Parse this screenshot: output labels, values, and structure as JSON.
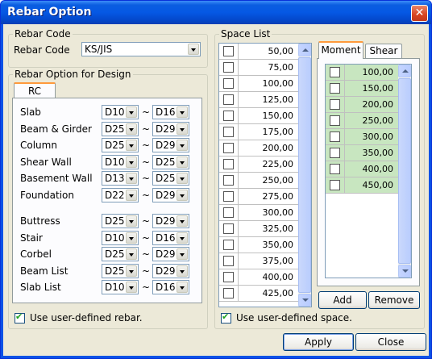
{
  "window": {
    "title": "Rebar Option",
    "close_glyph": "✕"
  },
  "rebar_code": {
    "group_label": "Rebar Code",
    "label": "Rebar Code",
    "value": "KS/JIS"
  },
  "design": {
    "group_label": "Rebar Option for Design",
    "tab": "RC",
    "tilde": "~",
    "rows": [
      {
        "label": "Slab",
        "min": "D10",
        "max": "D16"
      },
      {
        "label": "Beam & Girder",
        "min": "D25",
        "max": "D29"
      },
      {
        "label": "Column",
        "min": "D25",
        "max": "D29"
      },
      {
        "label": "Shear Wall",
        "min": "D10",
        "max": "D25"
      },
      {
        "label": "Basement Wall",
        "min": "D13",
        "max": "D25"
      },
      {
        "label": "Foundation",
        "min": "D22",
        "max": "D29"
      },
      {
        "label": "Buttress",
        "min": "D25",
        "max": "D29"
      },
      {
        "label": "Stair",
        "min": "D10",
        "max": "D16"
      },
      {
        "label": "Corbel",
        "min": "D25",
        "max": "D29"
      },
      {
        "label": "Beam List",
        "min": "D25",
        "max": "D29"
      },
      {
        "label": "Slab List",
        "min": "D10",
        "max": "D16"
      }
    ],
    "user_defined_label": "Use user-defined rebar."
  },
  "space": {
    "group_label": "Space List",
    "values": [
      "50,00",
      "75,00",
      "100,00",
      "125,00",
      "150,00",
      "175,00",
      "200,00",
      "225,00",
      "250,00",
      "275,00",
      "300,00",
      "325,00",
      "350,00",
      "375,00",
      "400,00",
      "425,00"
    ],
    "tabs": [
      "Moment",
      "Shear"
    ],
    "moment_values": [
      "100,00",
      "150,00",
      "200,00",
      "250,00",
      "300,00",
      "350,00",
      "400,00",
      "450,00"
    ],
    "add_label": "Add",
    "remove_label": "Remove",
    "user_defined_label": "Use user-defined space."
  },
  "footer": {
    "apply_label": "Apply",
    "close_label": "Close"
  },
  "colors": {
    "titlebar": "#0558e4",
    "dialog_bg": "#ece9d8",
    "selected_cell": "#c8e6c0"
  }
}
